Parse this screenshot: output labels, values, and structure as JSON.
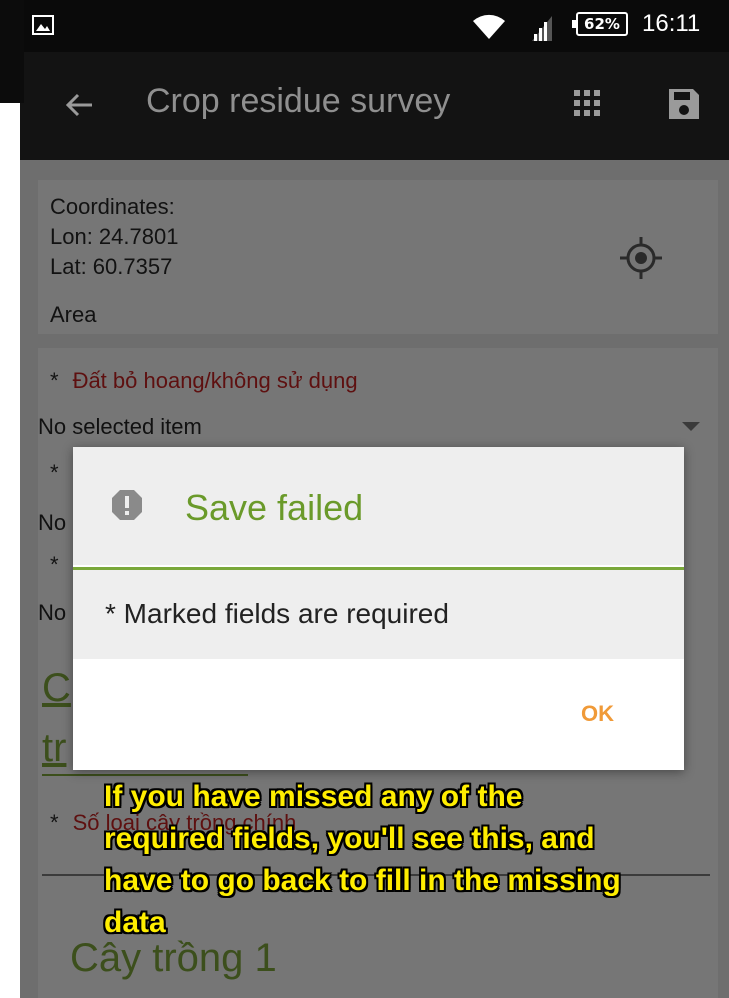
{
  "status_bar": {
    "battery": "62%",
    "time": "16:11",
    "icons": [
      "photo-icon",
      "wifi-icon",
      "signal-icon",
      "battery-icon"
    ]
  },
  "toolbar": {
    "title": "Crop residue survey",
    "icons": [
      "back-arrow-icon",
      "grid-icon",
      "save-icon"
    ]
  },
  "location": {
    "coordinates_label": "Coordinates:",
    "lon": "Lon: 24.7801",
    "lat": "Lat: 60.7357",
    "area_label": "Area",
    "icon": "gps-target-icon"
  },
  "form": {
    "field1_asterisk": "*",
    "field1_label": "Đất bỏ hoang/không sử dụng",
    "field1_value": "No selected item",
    "field2_asterisk": "*",
    "field2_value": "No",
    "field3_asterisk": "*",
    "field3_value": "No",
    "section_heading_line1": "C",
    "section_heading_line2": "tr",
    "field4_asterisk": "*",
    "field4_label": "Số loại cây trồng chính",
    "section2_heading": "Cây trồng 1"
  },
  "dialog": {
    "title": "Save failed",
    "message": "* Marked fields are required",
    "ok_label": "OK",
    "colors": {
      "title": "#6a9a2a",
      "ok": "#f09a38"
    }
  },
  "caption": {
    "line1": "If you have missed any of the",
    "line2": "required fields, you'll see this, and",
    "line3": "have to go back to fill in the missing",
    "line4": "data"
  }
}
